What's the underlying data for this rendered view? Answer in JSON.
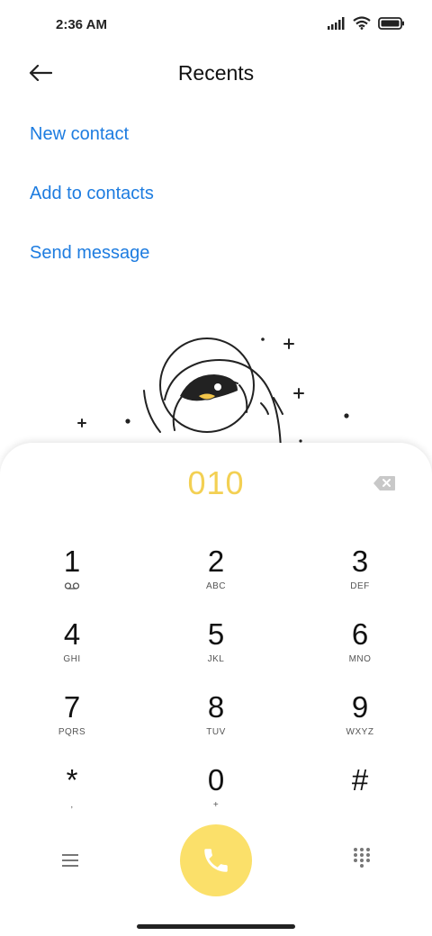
{
  "status_bar": {
    "time": "2:36 AM",
    "icons": [
      "signal-icon",
      "wifi-icon",
      "battery-icon"
    ]
  },
  "header": {
    "title": "Recents",
    "back_icon": "arrow-left-icon"
  },
  "actions": [
    {
      "label": "New contact"
    },
    {
      "label": "Add to contacts"
    },
    {
      "label": "Send message"
    }
  ],
  "dialpad": {
    "number": "010",
    "number_color": "#f3d053",
    "keys": [
      {
        "digit": "1",
        "letters": "",
        "icon": "voicemail-icon"
      },
      {
        "digit": "2",
        "letters": "ABC"
      },
      {
        "digit": "3",
        "letters": "DEF"
      },
      {
        "digit": "4",
        "letters": "GHI"
      },
      {
        "digit": "5",
        "letters": "JKL"
      },
      {
        "digit": "6",
        "letters": "MNO"
      },
      {
        "digit": "7",
        "letters": "PQRS"
      },
      {
        "digit": "8",
        "letters": "TUV"
      },
      {
        "digit": "9",
        "letters": "WXYZ"
      },
      {
        "digit": "*",
        "letters": ","
      },
      {
        "digit": "0",
        "letters": "+"
      },
      {
        "digit": "#",
        "letters": ""
      }
    ],
    "call_button_color": "#fbe06a",
    "link_color": "#1d7ce0"
  }
}
